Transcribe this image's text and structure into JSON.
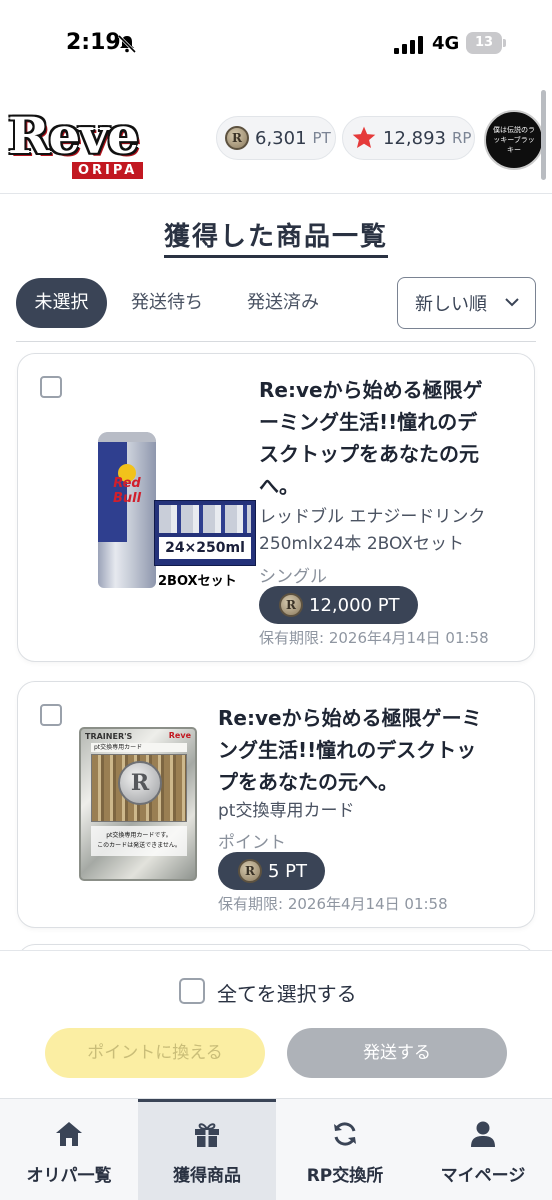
{
  "status_bar": {
    "time": "2:19",
    "network": "4G",
    "battery": "13"
  },
  "header": {
    "logo_text": "Reve",
    "logo_sub": "ORIPA",
    "points_value": "6,301",
    "points_unit": "PT",
    "rp_value": "12,893",
    "rp_unit": "RP",
    "avatar_text": "僕は伝説のラッキーブラッキー"
  },
  "page_title": "獲得した商品一覧",
  "tabs": [
    {
      "label": "未選択",
      "active": true
    },
    {
      "label": "発送待ち",
      "active": false
    },
    {
      "label": "発送済み",
      "active": false
    }
  ],
  "sort": {
    "selected": "新しい順"
  },
  "items": [
    {
      "title": "Re:veから始める極限ゲーミング生活!!憧れのデスクトップをあなたの元へ。",
      "title_lines": [
        "Re:veから始める極限ゲ",
        "ーミング生活!!憧れのデ",
        "スクトップをあなたの元",
        "へ。"
      ],
      "product_lines": [
        "レッドブル エナジードリンク",
        "250mlx24本 2BOXセット"
      ],
      "type": "シングル",
      "price": "12,000 PT",
      "expiry": "保有期限: 2026年4月14日 01:58",
      "image_labels": {
        "can_brand": "Red Bull",
        "box_label": "24×250ml",
        "caption": "2BOXセット"
      }
    },
    {
      "title": "Re:veから始める極限ゲーミング生活!!憧れのデスクトップをあなたの元へ。",
      "title_lines": [
        "Re:veから始める極限ゲーミ",
        "ング生活!!憧れのデスクトッ",
        "プをあなたの元へ。"
      ],
      "product_lines": [
        "pt交換専用カード"
      ],
      "type": "ポイント",
      "price": "5 PT",
      "expiry": "保有期限: 2026年4月14日 01:58",
      "image_labels": {
        "card_header": "TRAINER'S",
        "card_logo": "Reve",
        "card_name": "pt交換専用カード",
        "card_text_1": "pt交換専用カードです。",
        "card_text_2": "このカードは発送できません。"
      }
    }
  ],
  "select_all_label": "全てを選択する",
  "actions": {
    "convert_points": "ポイントに換える",
    "ship": "発送する"
  },
  "nav": [
    {
      "label": "オリパ一覧",
      "icon": "home-icon",
      "active": false
    },
    {
      "label": "獲得商品",
      "icon": "gift-icon",
      "active": true
    },
    {
      "label": "RP交換所",
      "icon": "exchange-icon",
      "active": false
    },
    {
      "label": "マイページ",
      "icon": "user-icon",
      "active": false
    }
  ],
  "colors": {
    "primary": "#3a4456",
    "star": "#e53a3a",
    "points_button": "#fbeea3",
    "ship_button": "#aeb2b8"
  }
}
